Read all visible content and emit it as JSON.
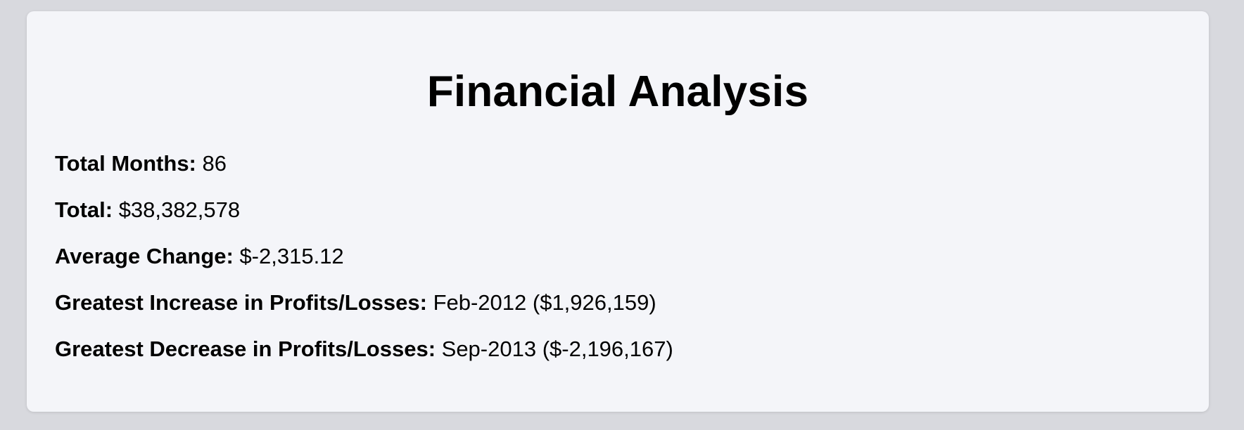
{
  "title": "Financial Analysis",
  "stats": [
    {
      "label": "Total Months:",
      "value": "86"
    },
    {
      "label": "Total:",
      "value": "$38,382,578"
    },
    {
      "label": "Average Change:",
      "value": "$-2,315.12"
    },
    {
      "label": "Greatest Increase in Profits/Losses:",
      "value": "Feb-2012 ($1,926,159)"
    },
    {
      "label": "Greatest Decrease in Profits/Losses:",
      "value": "Sep-2013 ($-2,196,167)"
    }
  ]
}
